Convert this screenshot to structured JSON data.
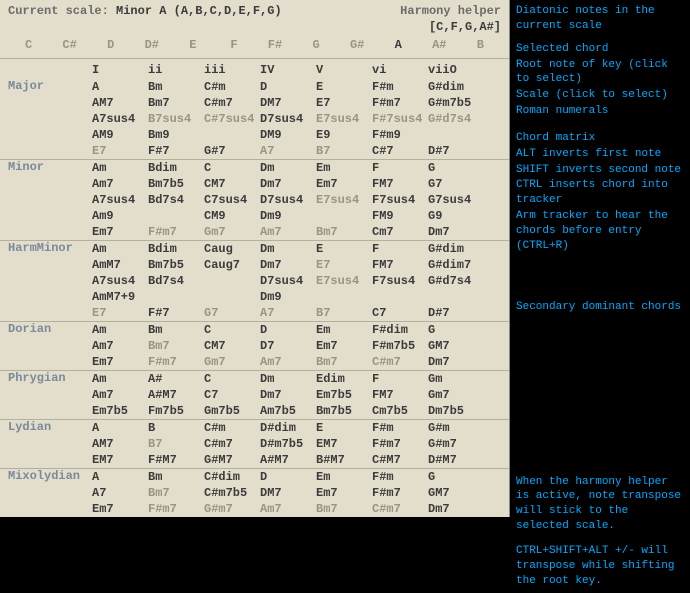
{
  "header": {
    "scale_prefix": "Current scale: ",
    "scale_name": "Minor A (A,B,C,D,E,F,G)",
    "title": "Harmony helper",
    "selected_chord": "[C,F,G,A#]"
  },
  "notes": [
    "C",
    "C#",
    "D",
    "D#",
    "E",
    "F",
    "F#",
    "G",
    "G#",
    "A",
    "A#",
    "B"
  ],
  "active_note": "A",
  "roman": [
    "I",
    "ii",
    "iii",
    "IV",
    "V",
    "vi",
    "viiO"
  ],
  "scales": [
    {
      "name": "Major",
      "rows": [
        [
          {
            "t": "A"
          },
          {
            "t": "Bm"
          },
          {
            "t": "C#m"
          },
          {
            "t": "D"
          },
          {
            "t": "E"
          },
          {
            "t": "F#m"
          },
          {
            "t": "G#dim"
          }
        ],
        [
          {
            "t": "AM7"
          },
          {
            "t": "Bm7"
          },
          {
            "t": "C#m7"
          },
          {
            "t": "DM7"
          },
          {
            "t": "E7"
          },
          {
            "t": "F#m7"
          },
          {
            "t": "G#m7b5"
          }
        ],
        [
          {
            "t": "A7sus4"
          },
          {
            "t": "B7sus4",
            "d": 1
          },
          {
            "t": "C#7sus4",
            "d": 1
          },
          {
            "t": "D7sus4"
          },
          {
            "t": "E7sus4",
            "d": 1
          },
          {
            "t": "F#7sus4",
            "d": 1
          },
          {
            "t": "G#d7s4",
            "d": 1
          }
        ],
        [
          {
            "t": "AM9"
          },
          {
            "t": "Bm9"
          },
          {
            "t": ""
          },
          {
            "t": "DM9"
          },
          {
            "t": "E9"
          },
          {
            "t": "F#m9"
          },
          {
            "t": ""
          }
        ],
        [
          {
            "t": "E7",
            "d": 1
          },
          {
            "t": "F#7"
          },
          {
            "t": "G#7"
          },
          {
            "t": "A7",
            "d": 1
          },
          {
            "t": "B7",
            "d": 1
          },
          {
            "t": "C#7"
          },
          {
            "t": "D#7"
          }
        ]
      ]
    },
    {
      "name": "Minor",
      "rows": [
        [
          {
            "t": "Am"
          },
          {
            "t": "Bdim"
          },
          {
            "t": "C"
          },
          {
            "t": "Dm"
          },
          {
            "t": "Em"
          },
          {
            "t": "F"
          },
          {
            "t": "G"
          }
        ],
        [
          {
            "t": "Am7"
          },
          {
            "t": "Bm7b5"
          },
          {
            "t": "CM7"
          },
          {
            "t": "Dm7"
          },
          {
            "t": "Em7"
          },
          {
            "t": "FM7"
          },
          {
            "t": "G7"
          }
        ],
        [
          {
            "t": "A7sus4"
          },
          {
            "t": "Bd7s4"
          },
          {
            "t": "C7sus4"
          },
          {
            "t": "D7sus4"
          },
          {
            "t": "E7sus4",
            "d": 1
          },
          {
            "t": "F7sus4"
          },
          {
            "t": "G7sus4"
          }
        ],
        [
          {
            "t": "Am9"
          },
          {
            "t": ""
          },
          {
            "t": "CM9"
          },
          {
            "t": "Dm9"
          },
          {
            "t": ""
          },
          {
            "t": "FM9"
          },
          {
            "t": "G9"
          }
        ],
        [
          {
            "t": "Em7"
          },
          {
            "t": "F#m7",
            "d": 1
          },
          {
            "t": "Gm7",
            "d": 1
          },
          {
            "t": "Am7",
            "d": 1
          },
          {
            "t": "Bm7",
            "d": 1
          },
          {
            "t": "Cm7"
          },
          {
            "t": "Dm7"
          }
        ]
      ]
    },
    {
      "name": "HarmMinor",
      "rows": [
        [
          {
            "t": "Am"
          },
          {
            "t": "Bdim"
          },
          {
            "t": "Caug"
          },
          {
            "t": "Dm"
          },
          {
            "t": "E"
          },
          {
            "t": "F"
          },
          {
            "t": "G#dim"
          }
        ],
        [
          {
            "t": "AmM7"
          },
          {
            "t": "Bm7b5"
          },
          {
            "t": "Caug7"
          },
          {
            "t": "Dm7"
          },
          {
            "t": "E7",
            "d": 1
          },
          {
            "t": "FM7"
          },
          {
            "t": "G#dim7"
          }
        ],
        [
          {
            "t": "A7sus4"
          },
          {
            "t": "Bd7s4"
          },
          {
            "t": ""
          },
          {
            "t": "D7sus4"
          },
          {
            "t": "E7sus4",
            "d": 1
          },
          {
            "t": "F7sus4"
          },
          {
            "t": "G#d7s4"
          }
        ],
        [
          {
            "t": "AmM7+9"
          },
          {
            "t": ""
          },
          {
            "t": ""
          },
          {
            "t": "Dm9"
          },
          {
            "t": ""
          },
          {
            "t": ""
          },
          {
            "t": ""
          }
        ],
        [
          {
            "t": "E7",
            "d": 1
          },
          {
            "t": "F#7"
          },
          {
            "t": "G7",
            "d": 1
          },
          {
            "t": "A7",
            "d": 1
          },
          {
            "t": "B7",
            "d": 1
          },
          {
            "t": "C7"
          },
          {
            "t": "D#7"
          }
        ]
      ]
    },
    {
      "name": "Dorian",
      "rows": [
        [
          {
            "t": "Am"
          },
          {
            "t": "Bm"
          },
          {
            "t": "C"
          },
          {
            "t": "D"
          },
          {
            "t": "Em"
          },
          {
            "t": "F#dim"
          },
          {
            "t": "G"
          }
        ],
        [
          {
            "t": "Am7"
          },
          {
            "t": "Bm7",
            "d": 1
          },
          {
            "t": "CM7"
          },
          {
            "t": "D7"
          },
          {
            "t": "Em7"
          },
          {
            "t": "F#m7b5"
          },
          {
            "t": "GM7"
          }
        ],
        [
          {
            "t": "Em7"
          },
          {
            "t": "F#m7",
            "d": 1
          },
          {
            "t": "Gm7",
            "d": 1
          },
          {
            "t": "Am7",
            "d": 1
          },
          {
            "t": "Bm7",
            "d": 1
          },
          {
            "t": "C#m7",
            "d": 1
          },
          {
            "t": "Dm7"
          }
        ]
      ]
    },
    {
      "name": "Phrygian",
      "rows": [
        [
          {
            "t": "Am"
          },
          {
            "t": "A#"
          },
          {
            "t": "C"
          },
          {
            "t": "Dm"
          },
          {
            "t": "Edim"
          },
          {
            "t": "F"
          },
          {
            "t": "Gm"
          }
        ],
        [
          {
            "t": "Am7"
          },
          {
            "t": "A#M7"
          },
          {
            "t": "C7"
          },
          {
            "t": "Dm7"
          },
          {
            "t": "Em7b5"
          },
          {
            "t": "FM7"
          },
          {
            "t": "Gm7"
          }
        ],
        [
          {
            "t": "Em7b5"
          },
          {
            "t": "Fm7b5"
          },
          {
            "t": "Gm7b5"
          },
          {
            "t": "Am7b5"
          },
          {
            "t": "Bm7b5"
          },
          {
            "t": "Cm7b5"
          },
          {
            "t": "Dm7b5"
          }
        ]
      ]
    },
    {
      "name": "Lydian",
      "rows": [
        [
          {
            "t": "A"
          },
          {
            "t": "B"
          },
          {
            "t": "C#m"
          },
          {
            "t": "D#dim"
          },
          {
            "t": "E"
          },
          {
            "t": "F#m"
          },
          {
            "t": "G#m"
          }
        ],
        [
          {
            "t": "AM7"
          },
          {
            "t": "B7",
            "d": 1
          },
          {
            "t": "C#m7"
          },
          {
            "t": "D#m7b5"
          },
          {
            "t": "EM7"
          },
          {
            "t": "F#m7"
          },
          {
            "t": "G#m7"
          }
        ],
        [
          {
            "t": "EM7"
          },
          {
            "t": "F#M7"
          },
          {
            "t": "G#M7"
          },
          {
            "t": "A#M7"
          },
          {
            "t": "B#M7"
          },
          {
            "t": "C#M7"
          },
          {
            "t": "D#M7"
          }
        ]
      ]
    },
    {
      "name": "Mixolydian",
      "rows": [
        [
          {
            "t": "A"
          },
          {
            "t": "Bm"
          },
          {
            "t": "C#dim"
          },
          {
            "t": "D"
          },
          {
            "t": "Em"
          },
          {
            "t": "F#m"
          },
          {
            "t": "G"
          }
        ],
        [
          {
            "t": "A7"
          },
          {
            "t": "Bm7",
            "d": 1
          },
          {
            "t": "C#m7b5"
          },
          {
            "t": "DM7"
          },
          {
            "t": "Em7"
          },
          {
            "t": "F#m7"
          },
          {
            "t": "GM7"
          }
        ],
        [
          {
            "t": "Em7"
          },
          {
            "t": "F#m7",
            "d": 1
          },
          {
            "t": "G#m7",
            "d": 1
          },
          {
            "t": "Am7",
            "d": 1
          },
          {
            "t": "Bm7",
            "d": 1
          },
          {
            "t": "C#m7",
            "d": 1
          },
          {
            "t": "Dm7"
          }
        ]
      ]
    }
  ],
  "annot": {
    "a1": "Diatonic notes in the current scale",
    "a2": "Selected chord",
    "a3": "Root note of key (click to select)",
    "a4": "Scale (click to select)",
    "a5": "Roman numerals",
    "a6": "Chord matrix",
    "a7": "ALT inverts first note",
    "a8": "SHIFT inverts second note",
    "a9": "CTRL inserts chord into tracker",
    "a10": "Arm tracker to hear the chords before entry (CTRL+R)",
    "a11": "Secondary dominant chords",
    "a12": "When the harmony helper is active, note transpose will stick to the selected scale.",
    "a13": "CTRL+SHIFT+ALT +/- will transpose while shifting the root key."
  }
}
